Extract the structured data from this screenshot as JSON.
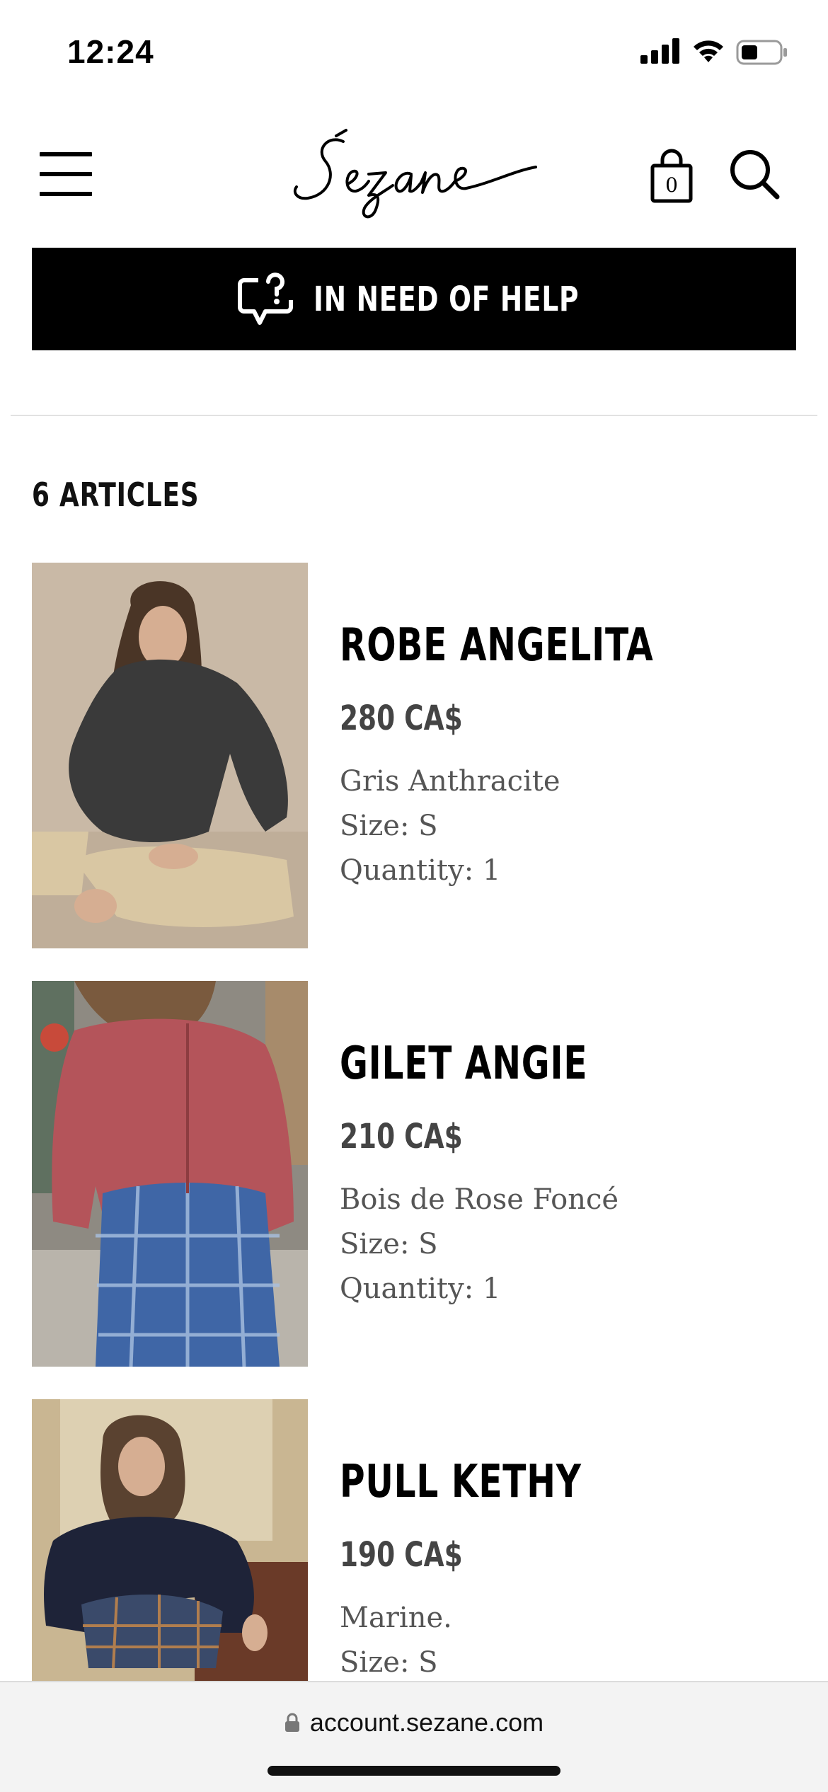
{
  "status_bar": {
    "time": "12:24",
    "icons": [
      "signal-icon",
      "wifi-icon",
      "battery-icon"
    ]
  },
  "header": {
    "logo_text": "Sézane",
    "bag_count": "0",
    "icons": [
      "hamburger-menu-icon",
      "shopping-bag-icon",
      "search-icon"
    ]
  },
  "help_banner": {
    "label": "IN NEED OF HELP",
    "icon": "chat-question-icon"
  },
  "articles": {
    "count_label": "6 ARTICLES",
    "items": [
      {
        "name": "ROBE ANGELITA",
        "price": "280 CA$",
        "color": "Gris Anthracite",
        "size": "Size: S",
        "quantity": "Quantity: 1",
        "image": "woman in dark grey knit dress seated"
      },
      {
        "name": "GILET ANGIE",
        "price": "210 CA$",
        "color": "Bois de Rose Foncé",
        "size": "Size: S",
        "quantity": "Quantity: 1",
        "image": "woman in pink cardigan and blue plaid trousers"
      },
      {
        "name": "PULL KETHY",
        "price": "190 CA$",
        "color": "Marine.",
        "size": "Size: S",
        "quantity": "",
        "image": "woman in navy sweater and plaid shorts seated"
      }
    ]
  },
  "browser": {
    "url": "account.sezane.com",
    "icon": "lock-icon"
  },
  "colors": {
    "banner_bg": "#000000",
    "banner_text": "#ffffff",
    "price_text": "#444444",
    "detail_text": "#555555"
  }
}
